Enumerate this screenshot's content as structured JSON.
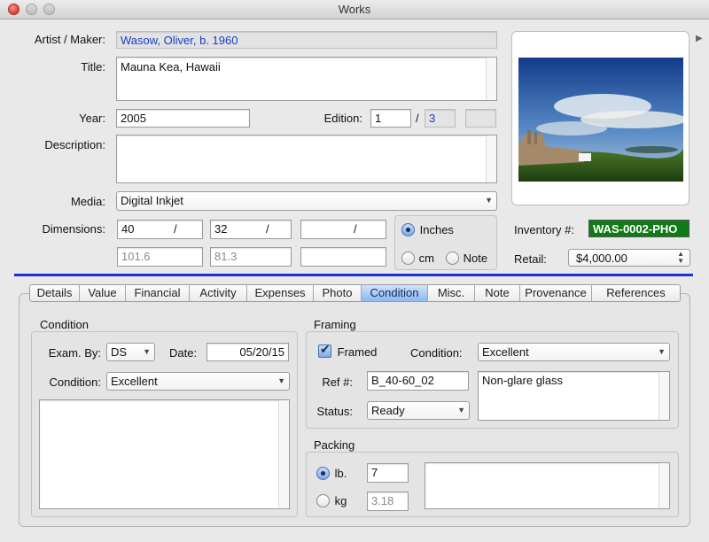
{
  "window": {
    "title": "Works"
  },
  "form": {
    "artist_label": "Artist / Maker:",
    "artist_value": "Wasow, Oliver, b. 1960",
    "title_label": "Title:",
    "title_value": "Mauna Kea, Hawaii",
    "year_label": "Year:",
    "year_value": "2005",
    "edition_label": "Edition:",
    "edition_number": "1",
    "edition_sep": "/",
    "edition_total": "3",
    "edition_extra": "",
    "description_label": "Description:",
    "description_value": "",
    "media_label": "Media:",
    "media_value": "Digital Inkjet",
    "dimensions_label": "Dimensions:",
    "dims": [
      {
        "value": "40",
        "sep": "/",
        "converted": "101.6"
      },
      {
        "value": "32",
        "sep": "/",
        "converted": "81.3"
      },
      {
        "value": "",
        "sep": "/",
        "converted": ""
      }
    ],
    "units": {
      "inches": "Inches",
      "cm": "cm",
      "note": "Note",
      "selected": "Inches"
    },
    "inventory_label": "Inventory #:",
    "inventory_value": "WAS-0002-PHO",
    "retail_label": "Retail:",
    "retail_value": "$4,000.00"
  },
  "colors": {
    "accent_rule": "#1432d6",
    "inventory_bg": "#0f7a16",
    "selected_tab": "#8db7ee"
  },
  "tabs": [
    "Details",
    "Value",
    "Financial",
    "Activity",
    "Expenses",
    "Photo",
    "Condition",
    "Misc.",
    "Note",
    "Provenance",
    "References"
  ],
  "selected_tab": "Condition",
  "condition": {
    "header": "Condition",
    "exam_label": "Exam. By:",
    "exam_value": "DS",
    "date_label": "Date:",
    "date_value": "05/20/15",
    "condition_label": "Condition:",
    "condition_value": "Excellent",
    "notes": ""
  },
  "framing": {
    "header": "Framing",
    "framed_label": "Framed",
    "framed": true,
    "condition_label": "Condition:",
    "condition_value": "Excellent",
    "ref_label": "Ref #:",
    "ref_value": "B_40-60_02",
    "status_label": "Status:",
    "status_value": "Ready",
    "notes": "Non-glare glass"
  },
  "packing": {
    "header": "Packing",
    "lb_label": "lb.",
    "lb_value": "7",
    "kg_label": "kg",
    "kg_value": "3.18",
    "selected": "lb.",
    "notes": ""
  },
  "icons": {
    "expand": "triangle-right-icon",
    "popup": "chevron-down-icon",
    "stepper": "up-down-arrows-icon"
  }
}
